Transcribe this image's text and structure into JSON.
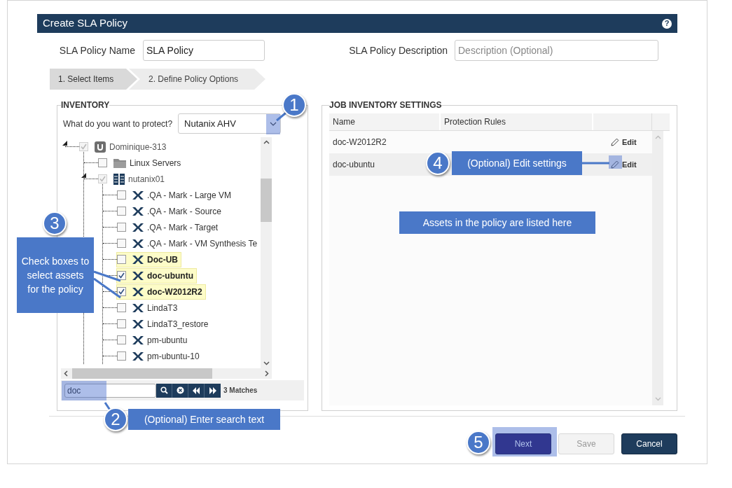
{
  "dialog": {
    "title": "Create SLA Policy",
    "help": "?"
  },
  "policy_name": {
    "label": "SLA Policy Name",
    "value": "SLA Policy"
  },
  "policy_description": {
    "label": "SLA Policy Description",
    "placeholder": "Description (Optional)"
  },
  "steps": [
    {
      "label": "1. Select Items",
      "selected": true
    },
    {
      "label": "2. Define Policy Options",
      "selected": false
    }
  ],
  "inventory": {
    "title": "INVENTORY",
    "protect_label": "What do you want to protect?",
    "protect_value": "Nutanix AHV",
    "tree": [
      {
        "label": "Dominique-313",
        "kind": "server",
        "checked": true,
        "disabled": true,
        "highlighted": false,
        "expanded": true,
        "children": [
          {
            "label": "Linux Servers",
            "kind": "folder",
            "checked": false,
            "disabled": false,
            "highlighted": false
          },
          {
            "label": "nutanix01",
            "kind": "cluster",
            "checked": true,
            "disabled": true,
            "highlighted": false,
            "expanded": true,
            "children": [
              {
                "label": ".QA - Mark - Large VM",
                "kind": "vm",
                "checked": false,
                "disabled": false,
                "highlighted": false
              },
              {
                "label": ".QA - Mark - Source",
                "kind": "vm",
                "checked": false,
                "disabled": false,
                "highlighted": false
              },
              {
                "label": ".QA - Mark - Target",
                "kind": "vm",
                "checked": false,
                "disabled": false,
                "highlighted": false
              },
              {
                "label": ".QA - Mark - VM Synthesis Te",
                "kind": "vm",
                "checked": false,
                "disabled": false,
                "highlighted": false
              },
              {
                "label": "Doc-UB",
                "kind": "vm",
                "checked": false,
                "disabled": false,
                "highlighted": true
              },
              {
                "label": "doc-ubuntu",
                "kind": "vm",
                "checked": true,
                "disabled": false,
                "highlighted": true
              },
              {
                "label": "doc-W2012R2",
                "kind": "vm",
                "checked": true,
                "disabled": false,
                "highlighted": true
              },
              {
                "label": "LindaT3",
                "kind": "vm",
                "checked": false,
                "disabled": false,
                "highlighted": false
              },
              {
                "label": "LindaT3_restore",
                "kind": "vm",
                "checked": false,
                "disabled": false,
                "highlighted": false
              },
              {
                "label": "pm-ubuntu",
                "kind": "vm",
                "checked": false,
                "disabled": false,
                "highlighted": false
              },
              {
                "label": "pm-ubuntu-10",
                "kind": "vm",
                "checked": false,
                "disabled": false,
                "highlighted": false
              }
            ]
          }
        ]
      }
    ],
    "search": {
      "value": "doc"
    },
    "matches": "3 Matches"
  },
  "job_inventory": {
    "title": "JOB INVENTORY SETTINGS",
    "columns": [
      "Name",
      "Protection Rules"
    ],
    "rows": [
      {
        "name": "doc-W2012R2",
        "action": "Edit",
        "hovered": false
      },
      {
        "name": "doc-ubuntu",
        "action": "Edit",
        "hovered": true
      }
    ]
  },
  "buttons": [
    {
      "label": "Next",
      "kind": "primary"
    },
    {
      "label": "Save",
      "kind": "disabled"
    },
    {
      "label": "Cancel",
      "kind": "secondary"
    }
  ],
  "callouts": [
    {
      "number": "1"
    },
    {
      "number": "2",
      "text": "(Optional) Enter search text"
    },
    {
      "number": "3",
      "text": "Check boxes to select assets for the policy"
    },
    {
      "number": "4",
      "text": "(Optional) Edit settings"
    },
    {
      "number": "5"
    }
  ],
  "note": "Assets in the policy are listed here"
}
